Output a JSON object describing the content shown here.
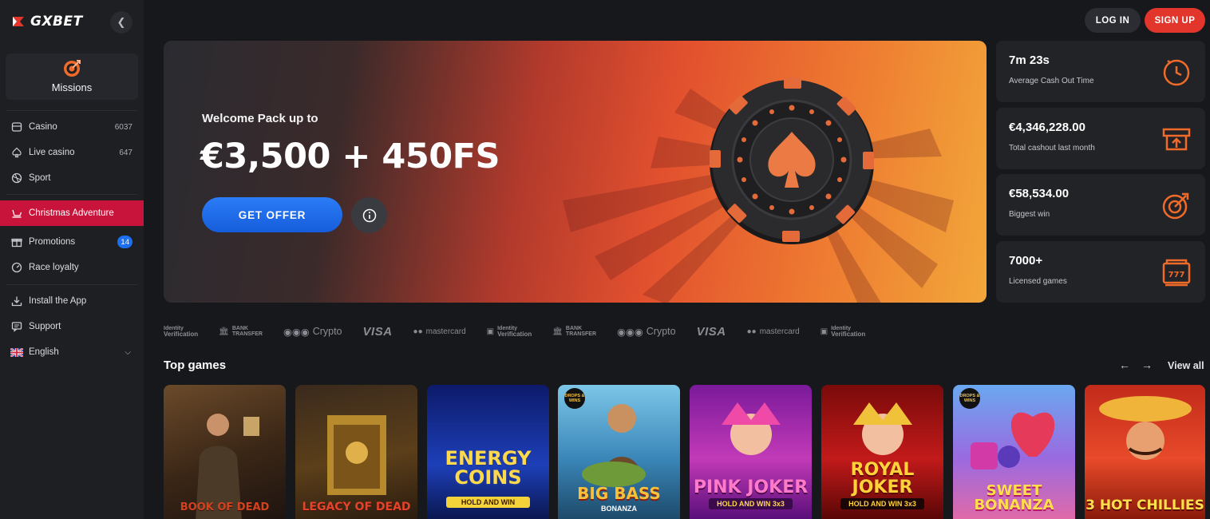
{
  "brand": {
    "name": "GXBET"
  },
  "sidebar": {
    "missions_label": "Missions",
    "items": [
      {
        "label": "Casino",
        "count": "6037"
      },
      {
        "label": "Live casino",
        "count": "647"
      },
      {
        "label": "Sport"
      },
      {
        "label": "Christmas Adventure"
      },
      {
        "label": "Promotions",
        "badge": "14"
      },
      {
        "label": "Race loyalty"
      },
      {
        "label": "Install the App"
      },
      {
        "label": "Support"
      },
      {
        "label": "English"
      }
    ]
  },
  "header": {
    "login": "LOG IN",
    "signup": "SIGN UP"
  },
  "hero": {
    "subtitle": "Welcome Pack up to",
    "title": "€3,500 + 450FS",
    "cta": "GET OFFER"
  },
  "stats": [
    {
      "value": "7m 23s",
      "label": "Average Cash Out Time"
    },
    {
      "value": "€4,346,228.00",
      "label": "Total cashout last month"
    },
    {
      "value": "€58,534.00",
      "label": "Biggest win"
    },
    {
      "value": "7000+",
      "label": "Licensed games"
    }
  ],
  "payments": {
    "identity_small": "Identity",
    "identity_big": "Verification",
    "bank_small": "BANK",
    "bank_big": "TRANSFER",
    "crypto": "Crypto",
    "visa": "VISA",
    "mastercard": "mastercard"
  },
  "top_games": {
    "title": "Top games",
    "view_all": "View all",
    "games": [
      {
        "title": "BOOK OF DEAD",
        "sub": ""
      },
      {
        "title": "LEGACY OF DEAD",
        "sub": ""
      },
      {
        "title": "ENERGY COINS",
        "sub": "HOLD AND WIN"
      },
      {
        "title": "BIG BASS",
        "sub": "BONANZA",
        "badge": "DROPS & WINS"
      },
      {
        "title": "PINK JOKER",
        "sub": "HOLD AND WIN 3x3"
      },
      {
        "title": "ROYAL JOKER",
        "sub": "HOLD AND WIN 3x3"
      },
      {
        "title": "SWEET BONANZA",
        "sub": "",
        "badge": "DROPS & WINS"
      },
      {
        "title": "3 HOT CHILLIES",
        "sub": ""
      }
    ]
  },
  "colors": {
    "accent_red": "#e2362c",
    "active_nav": "#c8143a",
    "cta_blue": "#1c6ff0",
    "icon_orange": "#f06a2a"
  }
}
